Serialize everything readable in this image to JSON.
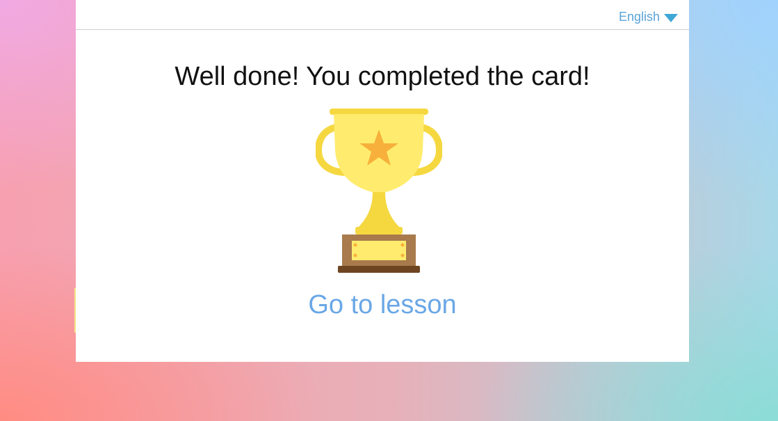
{
  "language_selector": {
    "label": "English",
    "icon": "chevron-down-icon",
    "icon_color": "#3fa7d6"
  },
  "completion": {
    "message": "Well done! You completed the card!",
    "image_icon": "trophy-icon",
    "cta_label": "Go to lesson"
  },
  "colors": {
    "link": "#6aa7e6",
    "trophy_gold": "#ffec6e",
    "trophy_accent": "#f5d840",
    "star": "#f7b03b",
    "base_wood": "#a87a4c",
    "base_dark": "#6e4521"
  }
}
